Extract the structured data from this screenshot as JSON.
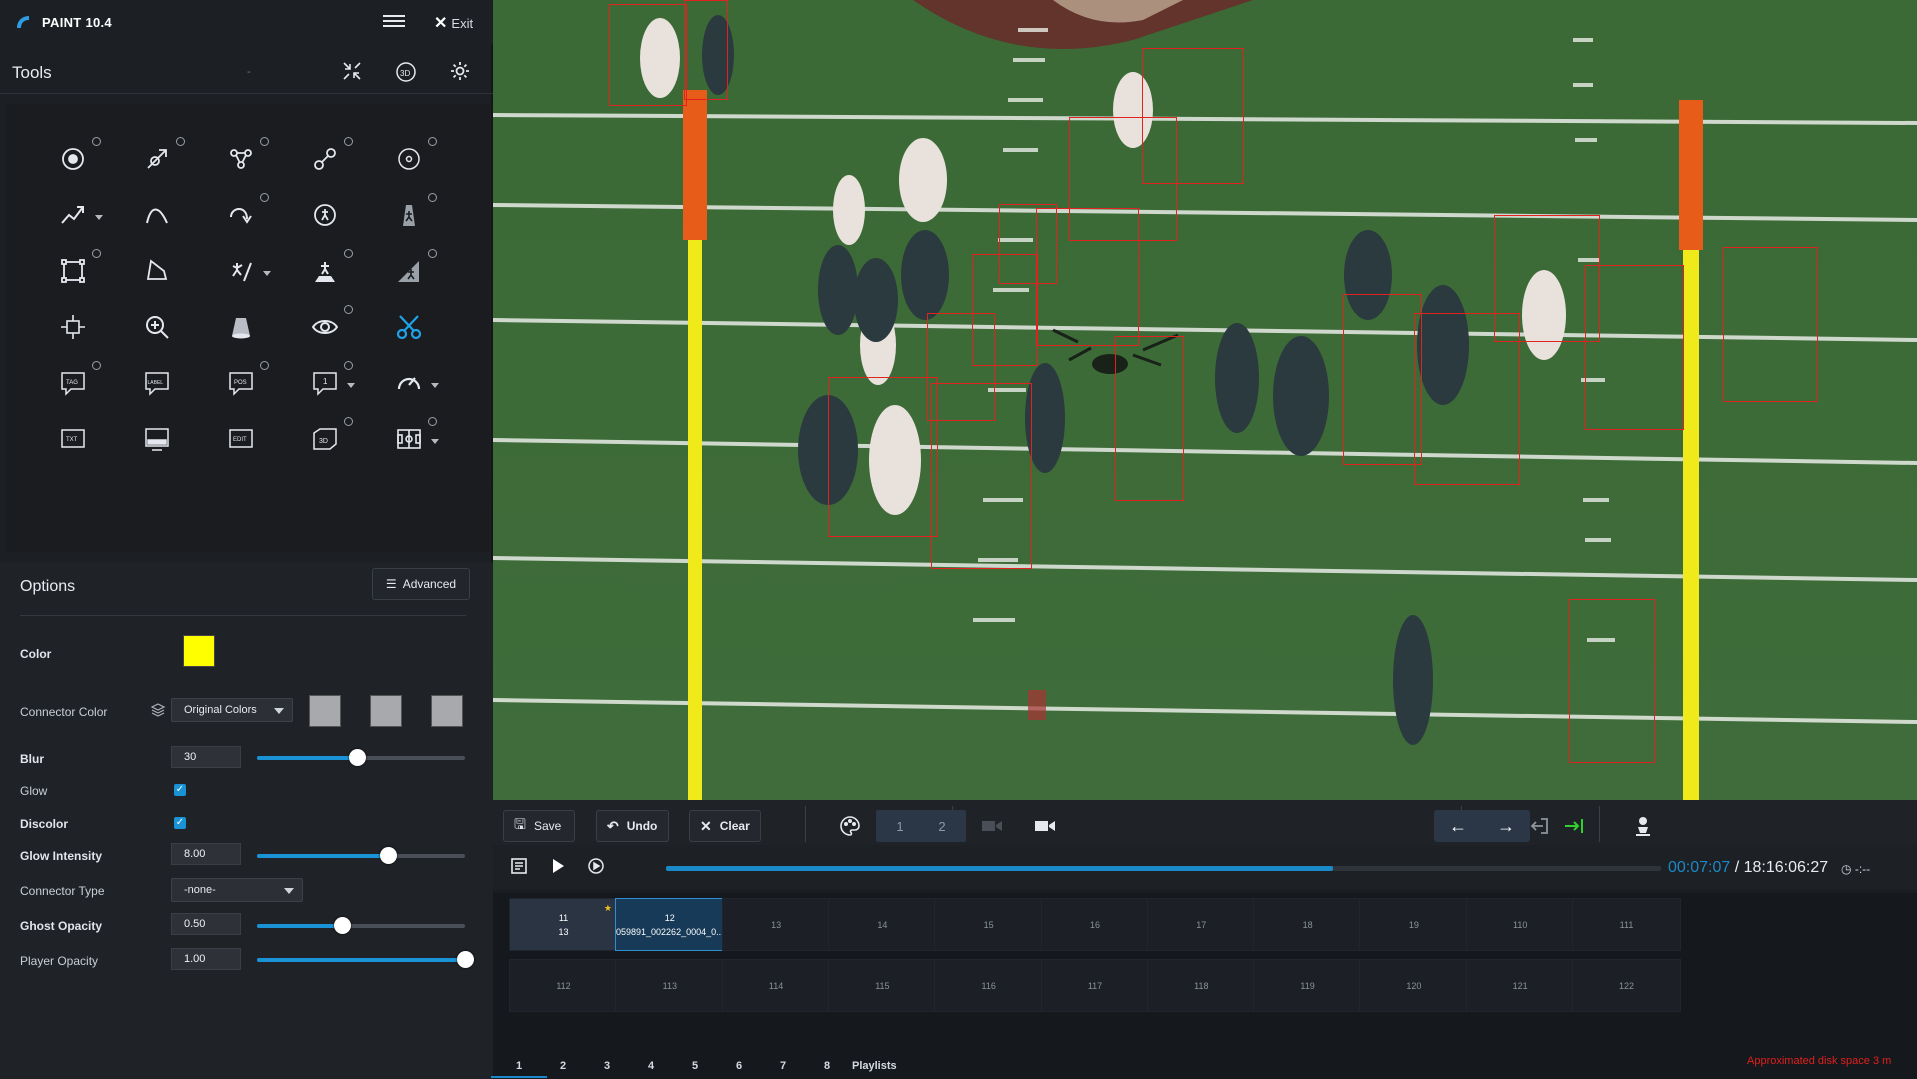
{
  "app": {
    "title": "PAINT 10.4",
    "exit_label": "Exit"
  },
  "tools": {
    "heading": "Tools",
    "dash": "-",
    "tag_label": "TAG",
    "label_label": "LABEL",
    "pos_label": "POS",
    "callout_num": "1",
    "txt_label": "TXT",
    "edit_label": "EDIT",
    "three_d_label": "3D"
  },
  "options": {
    "heading": "Options",
    "advanced_label": "Advanced",
    "color_label": "Color",
    "color_value": "#ffff00",
    "connector_color_label": "Connector Color",
    "connector_color_value": "Original Colors",
    "blur_label": "Blur",
    "blur_value": "30",
    "blur_level": 0.48,
    "glow_label": "Glow",
    "glow_checked": true,
    "discolor_label": "Discolor",
    "discolor_checked": true,
    "glow_intensity_label": "Glow Intensity",
    "glow_intensity_value": "8.00",
    "glow_intensity_level": 0.63,
    "connector_type_label": "Connector Type",
    "connector_type_value": "-none-",
    "ghost_opacity_label": "Ghost Opacity",
    "ghost_opacity_value": "0.50",
    "ghost_opacity_level": 0.41,
    "player_opacity_label": "Player Opacity",
    "player_opacity_value": "1.00",
    "player_opacity_level": 1.0
  },
  "controls": {
    "save_label": "Save",
    "undo_label": "Undo",
    "clear_label": "Clear",
    "cam1": "1",
    "cam2": "2"
  },
  "timeline": {
    "current": "00:07:07",
    "separator": " / ",
    "total": "18:16:06:27",
    "progress": 0.67,
    "speed": "-:--"
  },
  "clips": [
    {
      "line1": "11",
      "line2": "13"
    },
    {
      "line1": "12",
      "line2": "059891_002262_0004_0..."
    },
    {
      "line1": "13"
    },
    {
      "line1": "14"
    },
    {
      "line1": "15"
    },
    {
      "line1": "16"
    },
    {
      "line1": "17"
    },
    {
      "line1": "18"
    },
    {
      "line1": "19"
    },
    {
      "line1": "110"
    },
    {
      "line1": "111"
    },
    {
      "line1": "112"
    },
    {
      "line1": "113"
    },
    {
      "line1": "114"
    },
    {
      "line1": "115"
    },
    {
      "line1": "116"
    },
    {
      "line1": "117"
    },
    {
      "line1": "118"
    },
    {
      "line1": "119"
    },
    {
      "line1": "120"
    },
    {
      "line1": "121"
    },
    {
      "line1": "122"
    }
  ],
  "tabs": [
    "1",
    "2",
    "3",
    "4",
    "5",
    "6",
    "7",
    "8",
    "Playlists"
  ],
  "active_tab": "1",
  "disk_space": "Approximated disk space 3 m",
  "colors": {
    "accent": "#1a89c7",
    "box": "#e0231f",
    "pole": "#f4ea1c",
    "field": "#3f6b39",
    "alert": "#e0201c"
  }
}
